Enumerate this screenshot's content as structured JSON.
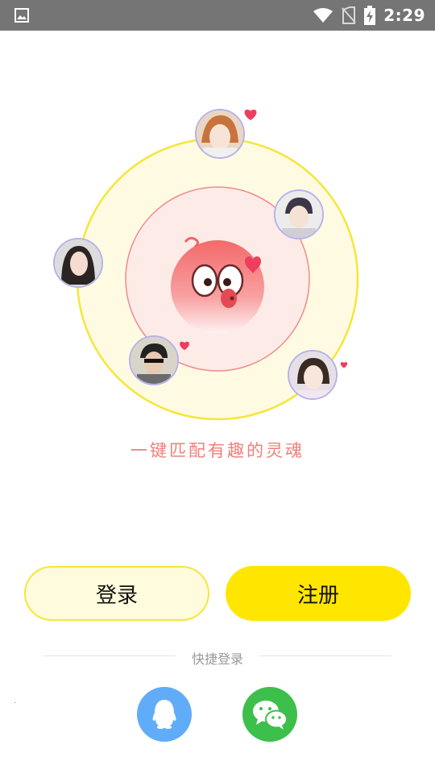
{
  "status_bar": {
    "time": "2:29",
    "icons": [
      "gallery-icon",
      "wifi-icon",
      "no-sim-icon",
      "battery-charging-icon"
    ]
  },
  "match": {
    "tagline": "一键匹配有趣的灵魂",
    "center_mascot": "pink-bird-mascot",
    "avatars": [
      "avatar-top",
      "avatar-right-upper",
      "avatar-left",
      "avatar-lower-left",
      "avatar-right-lower"
    ]
  },
  "buttons": {
    "login_label": "登录",
    "register_label": "注册"
  },
  "quick_login": {
    "label": "快捷登录",
    "providers": [
      "qq-icon",
      "wechat-icon"
    ]
  },
  "colors": {
    "status_bar": "#757575",
    "tagline": "#ef7f7a",
    "primary_yellow": "#ffe600",
    "outer_ring": "#f5e63a",
    "inner_ring": "#ef8c8c",
    "heart": "#ee3d5d",
    "qq": "#61acf8",
    "wechat": "#3dbf4b"
  }
}
